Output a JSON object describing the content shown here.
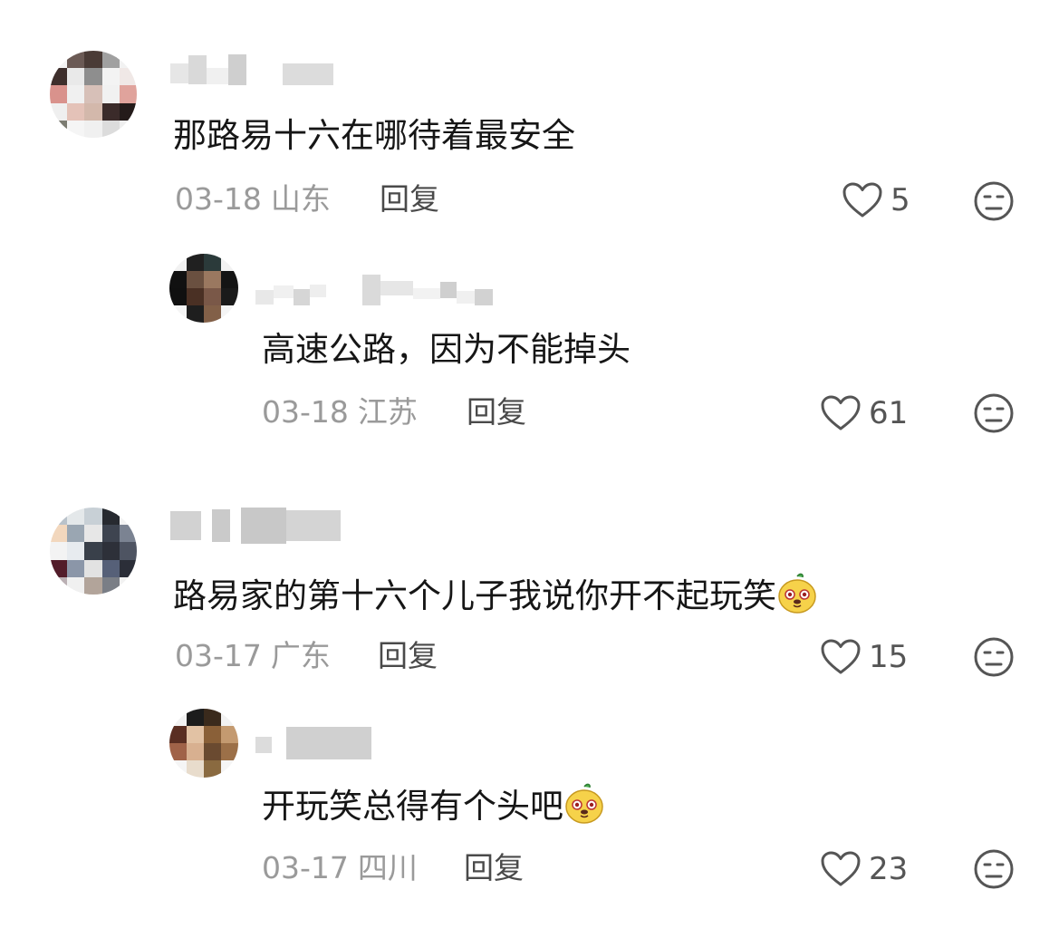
{
  "comments": [
    {
      "text": "那路易十六在哪待着最安全",
      "date": "03-18",
      "location": "山东",
      "reply_label": "回复",
      "likes": "5",
      "replies": [
        {
          "text": "高速公路，因为不能掉头",
          "date": "03-18",
          "location": "江苏",
          "reply_label": "回复",
          "likes": "61"
        }
      ]
    },
    {
      "text": "路易家的第十六个儿子我说你开不起玩笑",
      "date": "03-17",
      "location": "广东",
      "reply_label": "回复",
      "likes": "15",
      "emoji": "doge-emoji",
      "replies": [
        {
          "text": "开玩笑总得有个头吧",
          "date": "03-17",
          "location": "四川",
          "reply_label": "回复",
          "likes": "23",
          "emoji": "doge-emoji"
        }
      ]
    }
  ],
  "colors": {
    "text": "#161616",
    "meta": "#9a9a9a",
    "reply": "#4a4a4a",
    "icon": "#555555",
    "emoji_face": "#f6d24a"
  },
  "icons": [
    "heart-icon",
    "dislike-face-icon",
    "doge-emoji"
  ]
}
